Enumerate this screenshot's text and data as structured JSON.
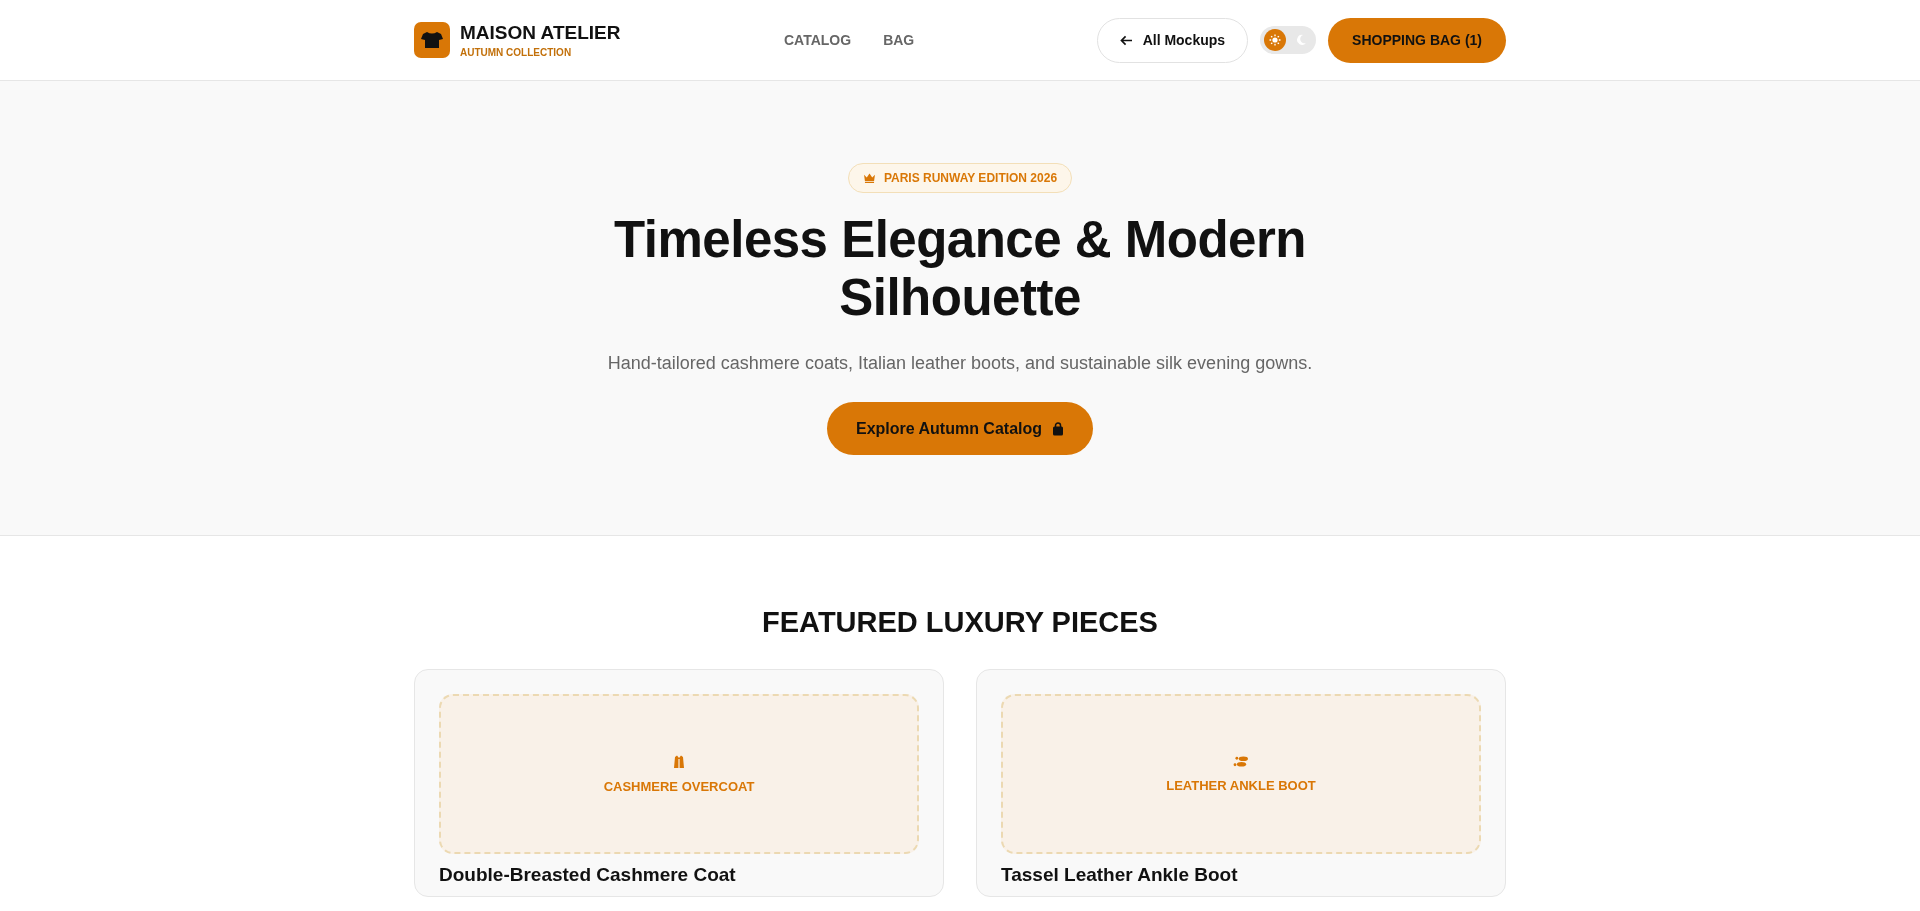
{
  "header": {
    "brand": "MAISON ATELIER",
    "tagline": "AUTUMN COLLECTION",
    "nav": [
      {
        "label": "CATALOG",
        "selected": false
      },
      {
        "label": "BAG",
        "selected": false
      }
    ],
    "back_button": "All Mockups",
    "theme_toggle": {
      "dark": false
    },
    "bag_button": "SHOPPING BAG (1)"
  },
  "hero": {
    "badge": "PARIS RUNWAY EDITION 2026",
    "title": "Timeless Elegance & Modern Silhouette",
    "subtitle": "Hand-tailored cashmere coats, Italian leather boots, and sustainable silk evening gowns.",
    "cta": "Explore Autumn Catalog"
  },
  "featured": {
    "title": "FEATURED LUXURY PIECES",
    "products": [
      {
        "kind": "vest",
        "image_label": "CASHMERE OVERCOAT",
        "name": "Double-Breasted Cashmere Coat"
      },
      {
        "kind": "shoes",
        "image_label": "LEATHER ANKLE BOOT",
        "name": "Tassel Leather Ankle Boot"
      }
    ]
  }
}
